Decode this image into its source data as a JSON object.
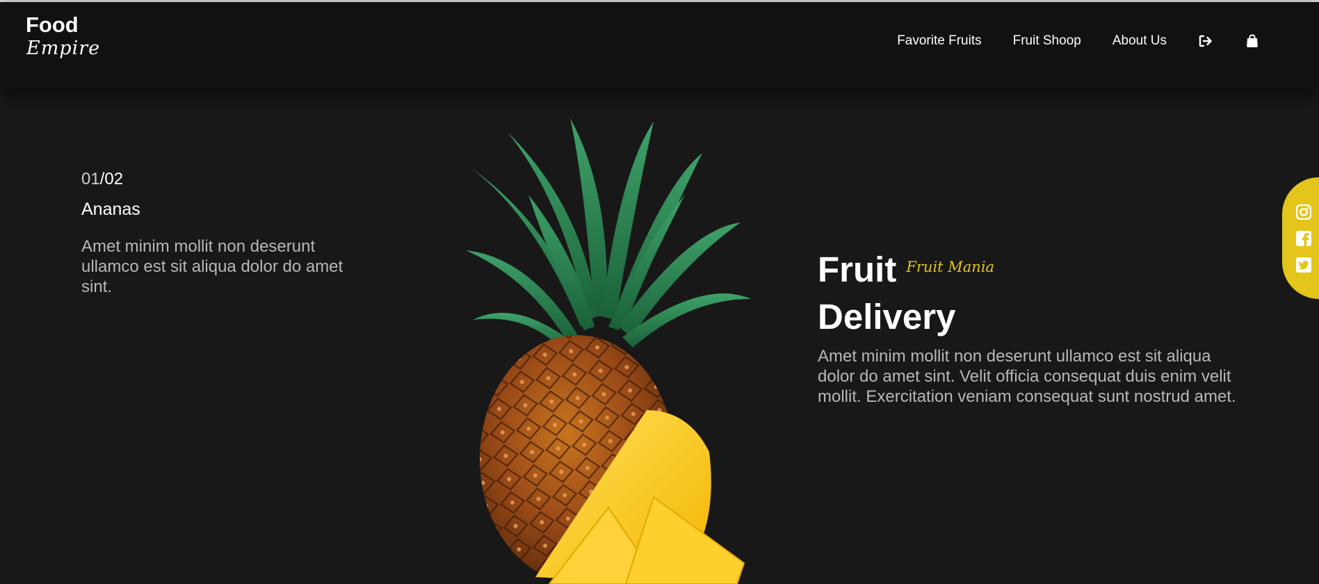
{
  "brand": {
    "name": "Food",
    "tagline": "Empire"
  },
  "nav": {
    "links": [
      {
        "label": "Favorite Fruits"
      },
      {
        "label": "Fruit Shoop"
      },
      {
        "label": "About Us"
      }
    ],
    "icons": [
      "sign-out-icon",
      "shopping-bag-icon"
    ]
  },
  "slider": {
    "current": "01",
    "separator": "/",
    "total": "02",
    "fruit_name": "Ananas",
    "description": "Amet minim mollit non deserunt ullamco est sit aliqua dolor do amet sint."
  },
  "hero": {
    "title_line1": "Fruit",
    "title_tag": "Fruit Mania",
    "title_line2": "Delivery",
    "description": "Amet minim mollit non deserunt ullamco est sit aliqua dolor do amet sint. Velit officia consequat duis enim velit mollit. Exercitation veniam consequat sunt nostrud amet."
  },
  "social": {
    "icons": [
      "instagram-icon",
      "facebook-icon",
      "twitter-icon"
    ]
  },
  "colors": {
    "background": "#181818",
    "navbar": "#111111",
    "accent": "#e3c51b",
    "muted_text": "#b8b8b8"
  }
}
